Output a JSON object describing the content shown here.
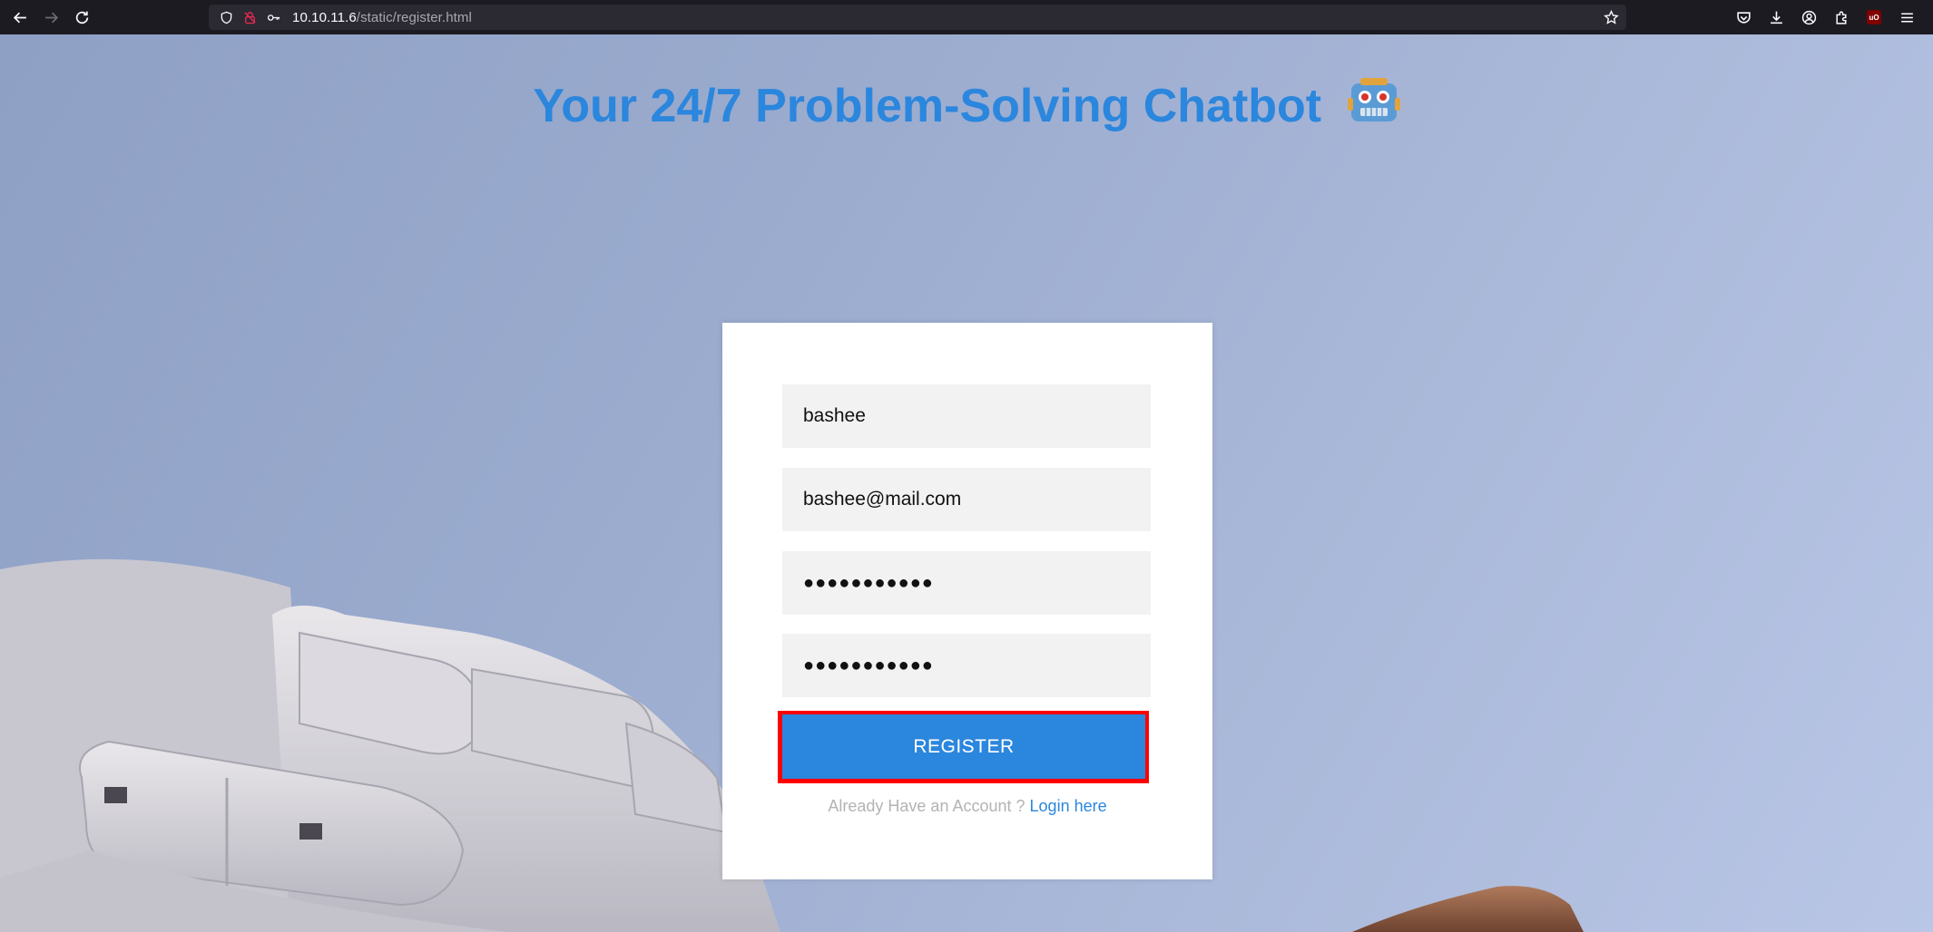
{
  "browser": {
    "url_host": "10.10.11.6",
    "url_path": "/static/register.html",
    "toolbar_icons": [
      "back-icon",
      "forward-icon",
      "reload-icon",
      "shield-icon",
      "lock-insecure-icon",
      "key-icon",
      "star-icon",
      "pocket-icon",
      "download-icon",
      "account-icon",
      "extensions-icon",
      "ublock-icon",
      "menu-icon"
    ],
    "ublock_label": "uO"
  },
  "page": {
    "title": "Your 24/7 Problem-Solving Chatbot",
    "title_emoji": "robot-icon"
  },
  "form": {
    "username_value": "bashee",
    "email_value": "bashee@mail.com",
    "password_value": "●●●●●●●●●●●",
    "confirm_password_value": "●●●●●●●●●●●",
    "register_label": "REGISTER",
    "account_prompt": "Already Have an Account ?",
    "login_link": "Login here"
  },
  "colors": {
    "accent": "#2b86dd",
    "highlight": "#ff0000",
    "field_bg": "#f2f2f2"
  }
}
